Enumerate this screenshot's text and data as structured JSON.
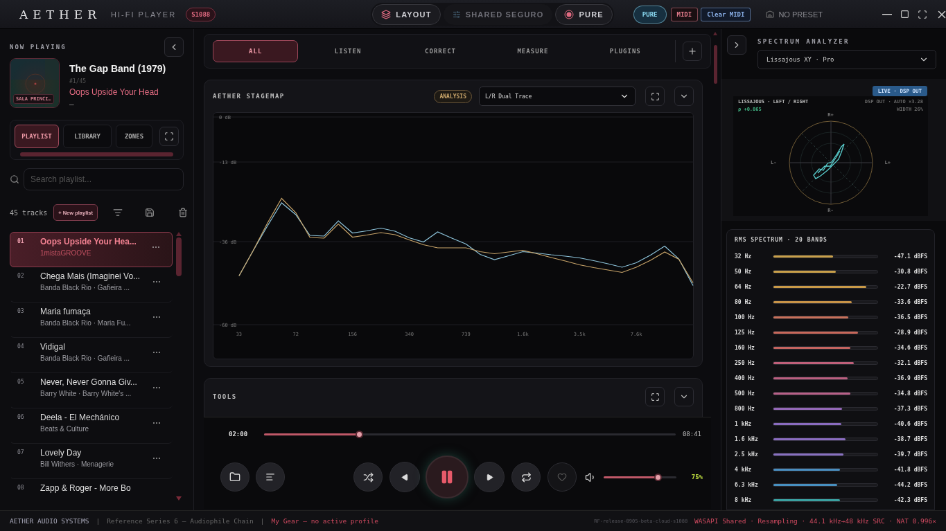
{
  "topbar": {
    "logo": "AETHER",
    "subtitle": "HI-FI PLAYER",
    "badge": "S1088",
    "modes": [
      {
        "label": "LAYOUT",
        "active": true
      },
      {
        "label": "SHARED SEGURO",
        "active": false
      },
      {
        "label": "PURE",
        "active": true
      }
    ],
    "pure_pill": "PURE",
    "midi": "MIDI",
    "clear_midi": "Clear MIDI",
    "preset": "NO PRESET"
  },
  "now_playing": {
    "heading": "NOW PLAYING",
    "art_label": "SALA PRINCI…",
    "album": "The Gap Band (1979)",
    "position": "#1/45",
    "title": "Oops Upside Your Head",
    "dash": "—"
  },
  "left_tabs": [
    {
      "label": "PLAYLIST",
      "selected": true
    },
    {
      "label": "LIBRARY",
      "selected": false
    },
    {
      "label": "ZONES",
      "selected": false
    }
  ],
  "search": {
    "placeholder": "Search playlist..."
  },
  "track_count": "45 tracks",
  "new_playlist": "+ New playlist",
  "tracks": [
    {
      "num": "01",
      "title": "Oops Upside Your Hea...",
      "artist": "1mistaGROOVE",
      "menu": "⋯",
      "selected": true
    },
    {
      "num": "02",
      "title": "Chega Mais (Imaginei Vo...",
      "artist": "Banda Black Rio · Gafieira ...",
      "menu": "⋯",
      "selected": false
    },
    {
      "num": "03",
      "title": "Maria fumaça",
      "artist": "Banda Black Rio · Maria Fu...",
      "menu": "⋯",
      "selected": false
    },
    {
      "num": "04",
      "title": "Vidigal",
      "artist": "Banda Black Rio · Gafieira ...",
      "menu": "⋯",
      "selected": false
    },
    {
      "num": "05",
      "title": "Never, Never Gonna Giv...",
      "artist": "Barry White · Barry White's ...",
      "menu": "⋯",
      "selected": false
    },
    {
      "num": "06",
      "title": "Deela - El Mechánico",
      "artist": "Beats & Culture",
      "menu": "⋯",
      "selected": false
    },
    {
      "num": "07",
      "title": "Lovely Day",
      "artist": "Bill Withers · Menagerie",
      "menu": "⋯",
      "selected": false
    },
    {
      "num": "08",
      "title": "Zapp & Roger - More Bo",
      "selected": false
    }
  ],
  "center_tabs": [
    {
      "label": "ALL",
      "selected": true
    },
    {
      "label": "LISTEN",
      "selected": false
    },
    {
      "label": "CORRECT",
      "selected": false
    },
    {
      "label": "MEASURE",
      "selected": false
    },
    {
      "label": "PLUGINS",
      "selected": false
    }
  ],
  "stagemap": {
    "title": "AETHER STAGEMAP",
    "badge": "ANALYSIS",
    "mode": "L/R Dual Trace",
    "chart_data": {
      "type": "line",
      "ylim": [
        -60,
        0
      ],
      "yticks": [
        {
          "value": 0,
          "label": "0 dB"
        },
        {
          "value": -13,
          "label": "-13 dB"
        },
        {
          "value": -36,
          "label": "-36 dB"
        },
        {
          "value": -60,
          "label": "-60 dB"
        }
      ],
      "categories": [
        "33",
        null,
        null,
        null,
        "72",
        null,
        null,
        null,
        "156",
        null,
        null,
        null,
        "340",
        null,
        null,
        null,
        "739",
        null,
        null,
        null,
        "1.6k",
        null,
        null,
        null,
        "3.5k",
        null,
        null,
        null,
        "7.6k",
        null,
        null,
        null,
        null
      ],
      "series": [
        {
          "color": "#8ec5dc",
          "values": [
            -45.9,
            -38.6,
            -31.5,
            -24.8,
            -28.2,
            -34.2,
            -34.4,
            -30.0,
            -33.5,
            -32.9,
            -32.1,
            -33.0,
            -34.9,
            -36.1,
            -33.2,
            -35.0,
            -36.7,
            -39.7,
            -41.2,
            -40.1,
            -38.9,
            -39.3,
            -39.8,
            -40.2,
            -40.7,
            -41.5,
            -42.4,
            -43.4,
            -42.1,
            -39.9,
            -37.3,
            -41.0,
            -48.7
          ]
        },
        {
          "color": "#c9a56a",
          "values": [
            -45.9,
            -38.6,
            -30.7,
            -23.5,
            -27.6,
            -34.8,
            -35.0,
            -30.9,
            -34.7,
            -34.1,
            -33.4,
            -34.0,
            -35.5,
            -36.9,
            -37.8,
            -37.8,
            -37.8,
            -38.9,
            -39.5,
            -39.0,
            -38.5,
            -39.5,
            -40.6,
            -41.6,
            -42.7,
            -43.5,
            -44.2,
            -44.9,
            -43.4,
            -41.4,
            -39.0,
            -41.1,
            -47.9
          ]
        }
      ]
    }
  },
  "tools": {
    "title": "TOOLS"
  },
  "player": {
    "elapsed": "02:00",
    "total": "08:41",
    "level": 0.23,
    "playing": true,
    "volume": {
      "level": 0.74,
      "reading": "75%"
    }
  },
  "analyzer": {
    "title": "SPECTRUM ANALYZER",
    "mode": "Lissajous XY · Pro",
    "live": "LIVE · DSP OUT",
    "scope": {
      "title": "LISSAJOUS · LEFT / RIGHT",
      "correlation": "ρ +0.865",
      "info": "DSP OUT · AUTO ×3.28",
      "width": "WIDTH 26%",
      "top": "R+",
      "bottom": "R-",
      "left": "L-",
      "right": "L+"
    }
  },
  "rms": {
    "title": "RMS SPECTRUM · 20 BANDS",
    "bands": [
      {
        "freq": "32 Hz",
        "level": 0.57,
        "reading": "-47.1 dBFS",
        "color": "#c9a04a"
      },
      {
        "freq": "50 Hz",
        "level": 0.6,
        "reading": "-30.8 dBFS",
        "color": "#c9a04a"
      },
      {
        "freq": "64 Hz",
        "level": 0.89,
        "reading": "-22.7 dBFS",
        "color": "#c99a48"
      },
      {
        "freq": "80 Hz",
        "level": 0.75,
        "reading": "-33.6 dBFS",
        "color": "#c89448"
      },
      {
        "freq": "100 Hz",
        "level": 0.72,
        "reading": "-36.5 dBFS",
        "color": "#c8705a"
      },
      {
        "freq": "125 Hz",
        "level": 0.81,
        "reading": "-28.9 dBFS",
        "color": "#c8685a"
      },
      {
        "freq": "160 Hz",
        "level": 0.74,
        "reading": "-34.6 dBFS",
        "color": "#c46460"
      },
      {
        "freq": "250 Hz",
        "level": 0.77,
        "reading": "-32.1 dBFS",
        "color": "#c0607a"
      },
      {
        "freq": "400 Hz",
        "level": 0.71,
        "reading": "-36.9 dBFS",
        "color": "#bb5f80"
      },
      {
        "freq": "500 Hz",
        "level": 0.74,
        "reading": "-34.8 dBFS",
        "color": "#b86088"
      },
      {
        "freq": "800 Hz",
        "level": 0.66,
        "reading": "-37.3 dBFS",
        "color": "#9468b8"
      },
      {
        "freq": "1 kHz",
        "level": 0.65,
        "reading": "-40.6 dBFS",
        "color": "#8a6cc0"
      },
      {
        "freq": "1.6 kHz",
        "level": 0.69,
        "reading": "-38.7 dBFS",
        "color": "#8a6cc0"
      },
      {
        "freq": "2.5 kHz",
        "level": 0.67,
        "reading": "-39.7 dBFS",
        "color": "#8870c0"
      },
      {
        "freq": "4 kHz",
        "level": 0.64,
        "reading": "-41.8 dBFS",
        "color": "#4a8ec0"
      },
      {
        "freq": "6.3 kHz",
        "level": 0.61,
        "reading": "-44.2 dBFS",
        "color": "#4890c0"
      },
      {
        "freq": "8 kHz",
        "level": 0.64,
        "reading": "-42.3 dBFS",
        "color": "#3aa0a0"
      }
    ]
  },
  "footer": {
    "brand": "AETHER AUDIO SYSTEMS",
    "sep1": "|",
    "sep2": "|",
    "series": "Reference Series 6 — Audiophile Chain",
    "gear": "My Gear — no active profile",
    "build": "RF-release-0905-beta-cloud-s1088",
    "status": "WASAPI Shared · Resampling · 44.1 kHz→48 kHz SRC · NAT 0.996×"
  }
}
